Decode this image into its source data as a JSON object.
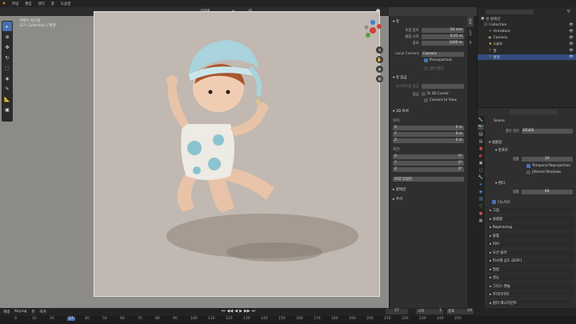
{
  "menu": [
    "파일",
    "편집",
    "렌더",
    "창",
    "도움말",
    "레이아웃",
    "모델링",
    "조각",
    "UV 편집",
    "텍스처 페인트",
    "셰이딩",
    "애니메이션",
    "렌더링"
  ],
  "viewport": {
    "view_name": "카메라 원근법",
    "collection": "(27) Collection | 헬멧",
    "shading_mode": "글로벌"
  },
  "npanel": {
    "tabs": [
      "항목",
      "도구",
      "뷰"
    ],
    "view_header": "뷰",
    "focal_label": "초점 길이",
    "focal_value": "50 mm",
    "clip_start_label": "클립 시작",
    "clip_start_value": "0.01 m",
    "clip_end_label": "종료",
    "clip_end_value": "1000 m",
    "local_camera_label": "Local Camera",
    "local_camera_value": "Camera",
    "passepartout_label": "Passepartout",
    "render_region_label": "렌더 영역",
    "view_lock_header": "뷰 잠금",
    "lock_object_label": "오브젝트를 잠금",
    "lock_label": "잠금",
    "to_3d_cursor": "To 3D Cursor",
    "camera_to_view": "Camera to View",
    "cursor_header": "3D 커서",
    "location_label": "위치:",
    "x_label": "X",
    "y_label": "Y",
    "z_label": "Z",
    "loc_x": "0 m",
    "loc_y": "0 m",
    "loc_z": "0 m",
    "rotation_label": "회전:",
    "rot_x": "0°",
    "rot_y": "0°",
    "rot_z": "0°",
    "rotation_mode": "XYZ 오일러",
    "collections_header": "컬렉션",
    "annotations_header": "주석"
  },
  "outliner": {
    "search_placeholder": "",
    "scene_collection": "씬 컬렉션",
    "items": [
      {
        "name": "Collection"
      },
      {
        "name": "Armature"
      },
      {
        "name": "Camera"
      },
      {
        "name": "Light"
      },
      {
        "name": "팔"
      },
      {
        "name": "헬멧"
      }
    ]
  },
  "properties": {
    "scene": "Scene",
    "render_engine_label": "렌더 엔진",
    "render_engine_value": "EEVEE",
    "sampling_header": "샘플링",
    "viewport_label": "뷰포트",
    "samples_label": "샘플",
    "samples_value": "16",
    "temporal_reprojection": "Temporal Reprojection",
    "jittered_shadows": "Jittered Shadows",
    "render_label": "렌더",
    "render_samples_label": "샘플",
    "render_samples_value": "64",
    "denoise_label": "디노이즈",
    "sections": [
      "그림",
      "클램핑",
      "Raytracing",
      "볼륨",
      "커브",
      "모션 블러",
      "피사계 심도 (DOF)",
      "필름",
      "성능",
      "그리스 펜슬",
      "프리이미지",
      "컬러 매니지먼트"
    ]
  },
  "timeline": {
    "playback": "재생",
    "keying": "Keying",
    "view": "뷰",
    "marker": "마커",
    "current_frame": "27",
    "start_label": "시작",
    "start_value": "1",
    "end_label": "종료",
    "end_value": "54",
    "ticks": [
      "0",
      "10",
      "20",
      "27",
      "40",
      "50",
      "60",
      "70",
      "80",
      "90",
      "100",
      "110",
      "120",
      "130",
      "140",
      "150",
      "160",
      "170",
      "180",
      "190",
      "200",
      "210",
      "220",
      "230",
      "240",
      "250"
    ]
  },
  "colors": {
    "accent": "#4772b3",
    "header": "#232323",
    "panel": "#2f2f2f"
  }
}
